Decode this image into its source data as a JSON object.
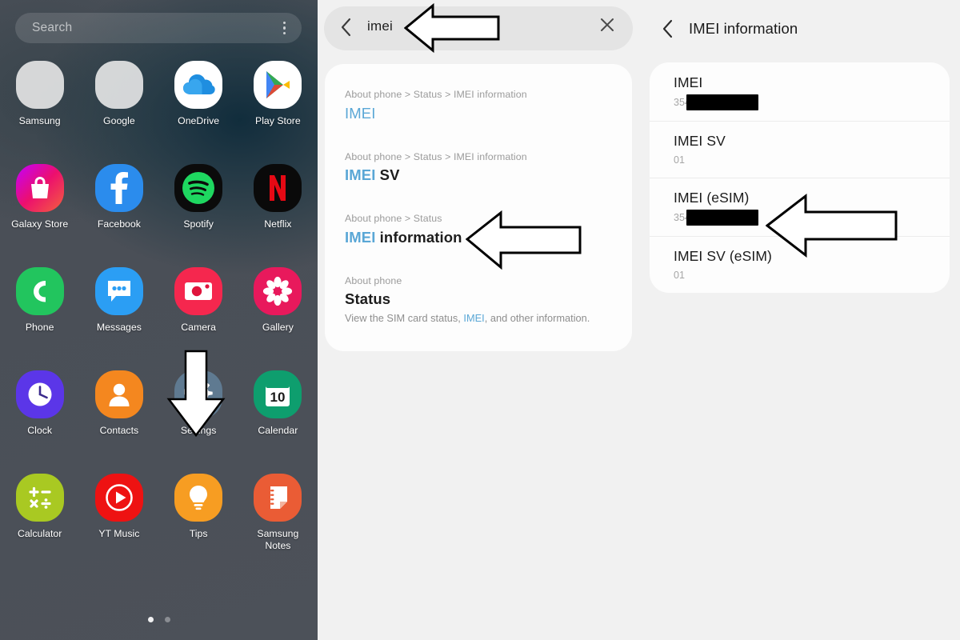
{
  "home": {
    "search": {
      "placeholder": "Search",
      "menu_icon": "more-vertical-icon"
    },
    "apps": [
      {
        "label": "Samsung",
        "icon": "samsung-folder-icon",
        "type": "folder",
        "dots": [
          "#7fc08a",
          "#e8453c",
          "#f6a623",
          "#5a7fd6",
          "#64c8a0",
          "#f0a32a",
          "#3fa9f5",
          "#9b59d0",
          "#4aa3df"
        ]
      },
      {
        "label": "Google",
        "icon": "google-folder-icon",
        "type": "folder",
        "dots": [
          "#4285f4",
          "#34a853",
          "#ea4335",
          "#fbbc05",
          "#ea4335",
          "#34a853",
          "#4285f4",
          "#4285f4",
          "#ea4335"
        ]
      },
      {
        "label": "OneDrive",
        "icon": "onedrive-icon",
        "type": "app"
      },
      {
        "label": "Play Store",
        "icon": "play-store-icon",
        "type": "app"
      },
      {
        "label": "Galaxy Store",
        "icon": "galaxy-store-icon",
        "type": "app"
      },
      {
        "label": "Facebook",
        "icon": "facebook-icon",
        "type": "app"
      },
      {
        "label": "Spotify",
        "icon": "spotify-icon",
        "type": "app"
      },
      {
        "label": "Netflix",
        "icon": "netflix-icon",
        "type": "app"
      },
      {
        "label": "Phone",
        "icon": "phone-icon",
        "type": "app"
      },
      {
        "label": "Messages",
        "icon": "messages-icon",
        "type": "app"
      },
      {
        "label": "Camera",
        "icon": "camera-icon",
        "type": "app"
      },
      {
        "label": "Gallery",
        "icon": "gallery-icon",
        "type": "app"
      },
      {
        "label": "Clock",
        "icon": "clock-icon",
        "type": "app"
      },
      {
        "label": "Contacts",
        "icon": "contacts-icon",
        "type": "app"
      },
      {
        "label": "Settings",
        "icon": "settings-gear-icon",
        "type": "app"
      },
      {
        "label": "Calendar",
        "icon": "calendar-icon",
        "type": "app",
        "day": "10"
      },
      {
        "label": "Calculator",
        "icon": "calculator-icon",
        "type": "app"
      },
      {
        "label": "YT Music",
        "icon": "youtube-music-icon",
        "type": "app"
      },
      {
        "label": "Tips",
        "icon": "tips-lightbulb-icon",
        "type": "app"
      },
      {
        "label": "Samsung Notes",
        "icon": "samsung-notes-icon",
        "type": "app"
      }
    ],
    "page_indicator": {
      "count": 2,
      "active": 0
    },
    "annotation_arrow": "white-down-arrow-pointing-to-settings"
  },
  "search_panel": {
    "back_icon": "chevron-left-icon",
    "query": "imei",
    "clear_icon": "close-x-icon",
    "results": [
      {
        "breadcrumb": "About phone > Status > IMEI information",
        "title_highlight": "IMEI",
        "title_rest": "",
        "bold": false,
        "desc": ""
      },
      {
        "breadcrumb": "About phone > Status > IMEI information",
        "title_highlight": "IMEI",
        "title_rest": " SV",
        "bold": true,
        "desc": ""
      },
      {
        "breadcrumb": "About phone > Status",
        "title_highlight": "IMEI",
        "title_rest": " information",
        "bold": true,
        "desc": ""
      },
      {
        "breadcrumb": "About phone",
        "title_highlight": "",
        "title_rest": "Status",
        "bold": true,
        "desc_pre": "View the SIM card status, ",
        "desc_hl": "IMEI",
        "desc_post": ", and other information."
      }
    ],
    "annotation_arrows": [
      "white-left-arrow-pointing-to-search-query",
      "white-left-arrow-pointing-to-imei-information-result"
    ]
  },
  "imei_panel": {
    "back_icon": "chevron-left-icon",
    "title": "IMEI information",
    "rows": [
      {
        "key": "IMEI",
        "value_prefix": "3544",
        "redacted": true,
        "redact_width": 90
      },
      {
        "key": "IMEI SV",
        "value_prefix": "01",
        "redacted": false,
        "redact_width": 0
      },
      {
        "key": "IMEI (eSIM)",
        "value_prefix": "3544",
        "redacted": true,
        "redact_width": 90
      },
      {
        "key": "IMEI SV (eSIM)",
        "value_prefix": "01",
        "redacted": false,
        "redact_width": 0
      }
    ],
    "annotation_arrow": "white-left-arrow-pointing-to-imei-esim-row"
  },
  "colors": {
    "home_bg": "#4a4f57",
    "panel_bg": "#f1f1f1",
    "card_bg": "#fdfdfd",
    "highlight_blue": "#5aa7d6",
    "muted_text": "#9b9b9b",
    "primary_text": "#1d1d1d"
  }
}
